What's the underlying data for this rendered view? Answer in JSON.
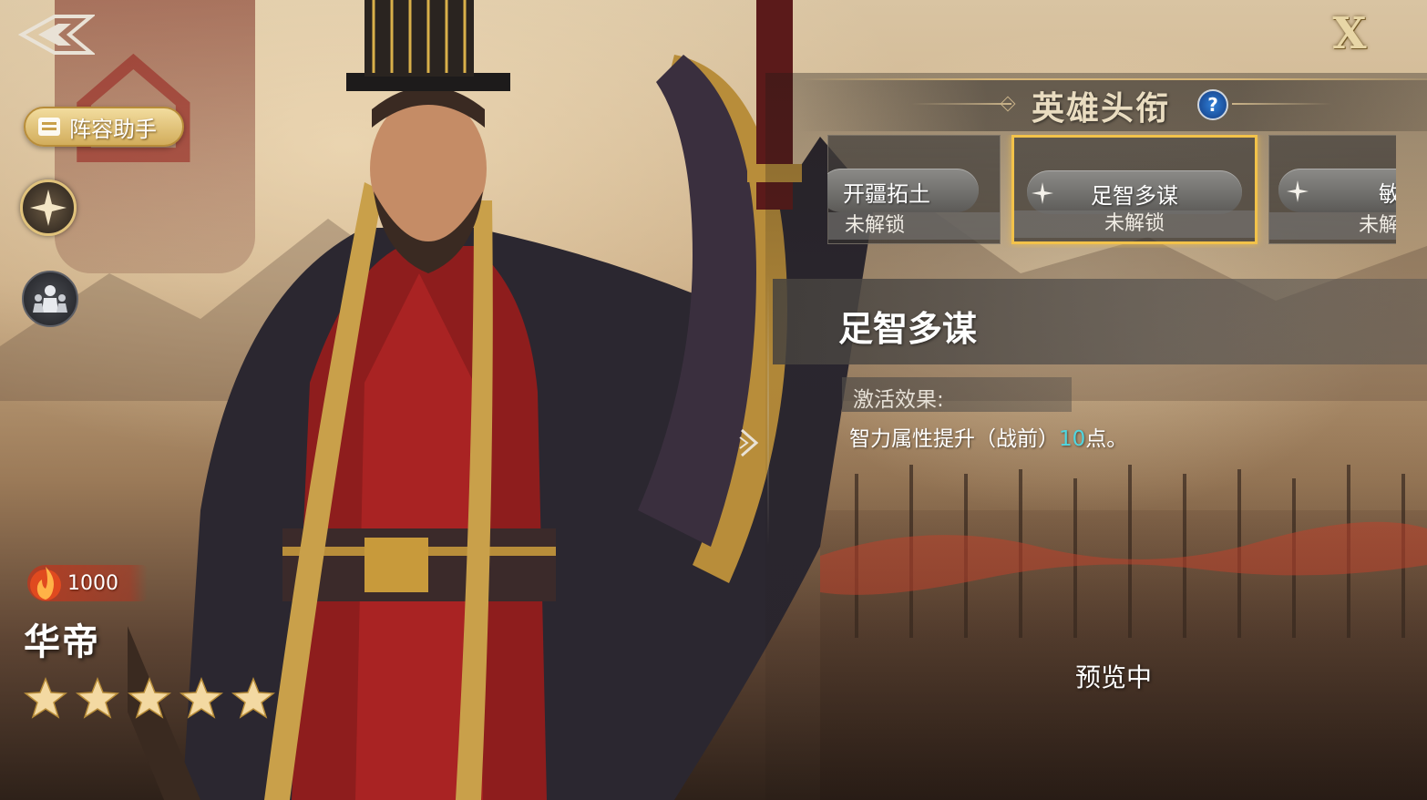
{
  "top": {
    "close_label": "X"
  },
  "left": {
    "lineup_label": "阵容助手"
  },
  "hero": {
    "power": "1000",
    "name": "华帝",
    "stars": 5
  },
  "panel": {
    "title": "英雄头衔",
    "help": "?",
    "titles": [
      {
        "name": "开疆拓土",
        "status": "未解锁",
        "selected": false
      },
      {
        "name": "足智多谋",
        "status": "未解锁",
        "selected": true
      },
      {
        "name": "敏",
        "status": "未解",
        "selected": false
      }
    ],
    "detail_title": "足智多谋",
    "effect_label": "激活效果:",
    "effect_prefix": "智力属性提升（战前）",
    "effect_value": "10",
    "effect_suffix": "点。",
    "preview": "预览中"
  },
  "colors": {
    "accent_gold": "#f2c24a",
    "highlight_cyan": "#4fd6e0"
  }
}
